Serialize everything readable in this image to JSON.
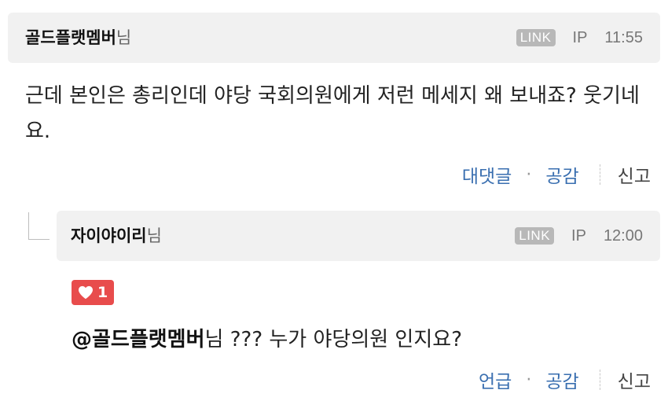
{
  "comment": {
    "author": "골드플랫멤버",
    "honorific": "님",
    "link_badge": "LINK",
    "ip_label": "IP",
    "time": "11:55",
    "body": "근데 본인은 총리인데 야당 국회의원에게 저런 메세지 왜 보내죠? 웃기네요.",
    "actions": {
      "reply": "대댓글",
      "separator": "·",
      "like": "공감",
      "report": "신고"
    }
  },
  "reply": {
    "author": "자이야이리",
    "honorific": "님",
    "link_badge": "LINK",
    "ip_label": "IP",
    "time": "12:00",
    "like_count": "1",
    "mention": "@골드플랫멤버",
    "body_rest": "님 ??? 누가 야당의원 인지요?",
    "actions": {
      "mention": "언급",
      "separator": "·",
      "like": "공감",
      "report": "신고"
    }
  },
  "colors": {
    "header_bg": "#f1f1f1",
    "action_blue": "#3a6fb0",
    "like_red": "#e84c4c",
    "link_badge_gray": "#b8b8b8"
  }
}
